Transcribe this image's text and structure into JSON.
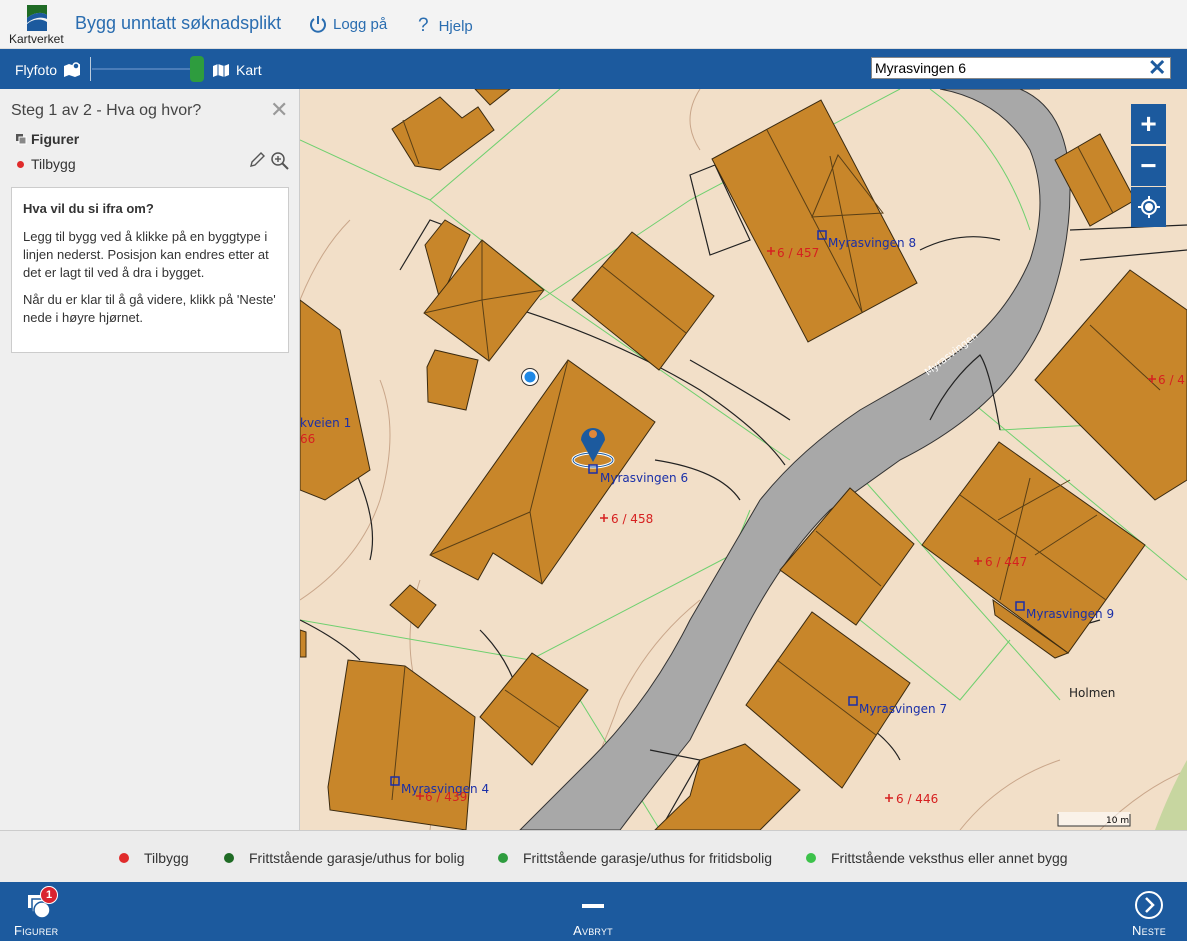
{
  "header": {
    "logo_text": "Kartverket",
    "app_title": "Bygg unntatt søknadsplikt",
    "login_label": "Logg på",
    "help_label": "Hjelp"
  },
  "toolbar": {
    "flyfoto_label": "Flyfoto",
    "kart_label": "Kart",
    "search_value": "Myrasvingen 6"
  },
  "sidebar": {
    "step_title": "Steg 1 av 2 - Hva og hvor?",
    "figures_heading": "Figurer",
    "figure_item": "Tilbygg",
    "info_title": "Hva vil du si ifra om?",
    "info_p1": "Legg til bygg ved å klikke på en byggtype i linjen nederst. Posisjon kan endres etter at det er lagt til ved å dra i bygget.",
    "info_p2": "Når du er klar til å gå videre, klikk på 'Neste' nede i høyre hjørnet."
  },
  "map": {
    "labels": {
      "addr_6": "Myrasvingen 6",
      "addr_8": "Myrasvingen 8",
      "addr_9": "Myrasvingen 9",
      "addr_7": "Myrasvingen 7",
      "addr_4": "Myrasvingen 4",
      "addr_kveien": "kveien 1",
      "parcel_458": "6 / 458",
      "parcel_457": "6 / 457",
      "parcel_447": "6 / 447",
      "parcel_446": "6 / 446",
      "parcel_439": "6 / 439",
      "parcel_66": "66",
      "parcel_4": "6 / 4",
      "road": "Myrasvingen",
      "place_holmen": "Holmen",
      "scale": "10 m"
    },
    "colors": {
      "building": "#c8862a",
      "road": "#a8a8a8",
      "background": "#f2dfc8"
    }
  },
  "legend": {
    "items": [
      {
        "label": "Tilbygg",
        "color": "#e02b2b"
      },
      {
        "label": "Frittstående garasje/uthus for bolig",
        "color": "#1f6b25"
      },
      {
        "label": "Frittstående garasje/uthus for fritidsbolig",
        "color": "#2e9c3e"
      },
      {
        "label": "Frittstående veksthus eller annet bygg",
        "color": "#3cc24a"
      }
    ]
  },
  "footer": {
    "figurer_label": "Figurer",
    "figurer_badge": "1",
    "avbryt_label": "Avbryt",
    "neste_label": "Neste"
  }
}
